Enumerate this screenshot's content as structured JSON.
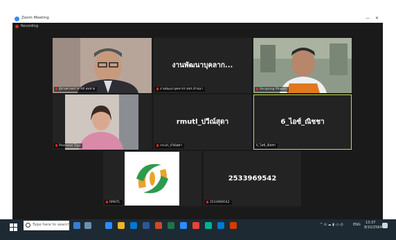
{
  "window": {
    "title": "Zoom Meeting",
    "recording_label": "Recording",
    "minimize_glyph": "—",
    "close_glyph": "✕"
  },
  "tiles": [
    {
      "name": "ผู้ช่วยศาสตราจารย์ สมชาย",
      "display_text": "",
      "muted": true,
      "active": false,
      "kind": "video-man-glasses"
    },
    {
      "name": "งานพัฒนาบุคลากร มทร.ล้านนา",
      "display_text": "งานพัฒนาบุคลาก...",
      "muted": true,
      "active": false,
      "kind": "text"
    },
    {
      "name": "Vorapong Phaosri",
      "display_text": "",
      "muted": true,
      "active": false,
      "kind": "video-man-orange"
    },
    {
      "name": "Peeranut Tiyu",
      "display_text": "",
      "muted": true,
      "active": false,
      "kind": "video-woman"
    },
    {
      "name": "rmutl_ปวีณ์สุดา",
      "display_text": "rmutl_ปวีณ์สุดา",
      "muted": true,
      "active": false,
      "kind": "text"
    },
    {
      "name": "6_ไอซ์_ณิชชา",
      "display_text": "6_ไอซ์_ณิชชา",
      "muted": false,
      "active": true,
      "kind": "text"
    },
    {
      "name": "RMUTL",
      "display_text": "",
      "muted": true,
      "active": false,
      "kind": "logo"
    },
    {
      "name": "2533969542",
      "display_text": "2533969542",
      "muted": true,
      "active": false,
      "kind": "text"
    }
  ],
  "taskbar": {
    "search_placeholder": "Type here to search",
    "time": "13:37",
    "date": "8/10/2564",
    "lang": "ENG",
    "colors": {
      "bg": "#1d2a33",
      "start": "#ffffff"
    }
  }
}
